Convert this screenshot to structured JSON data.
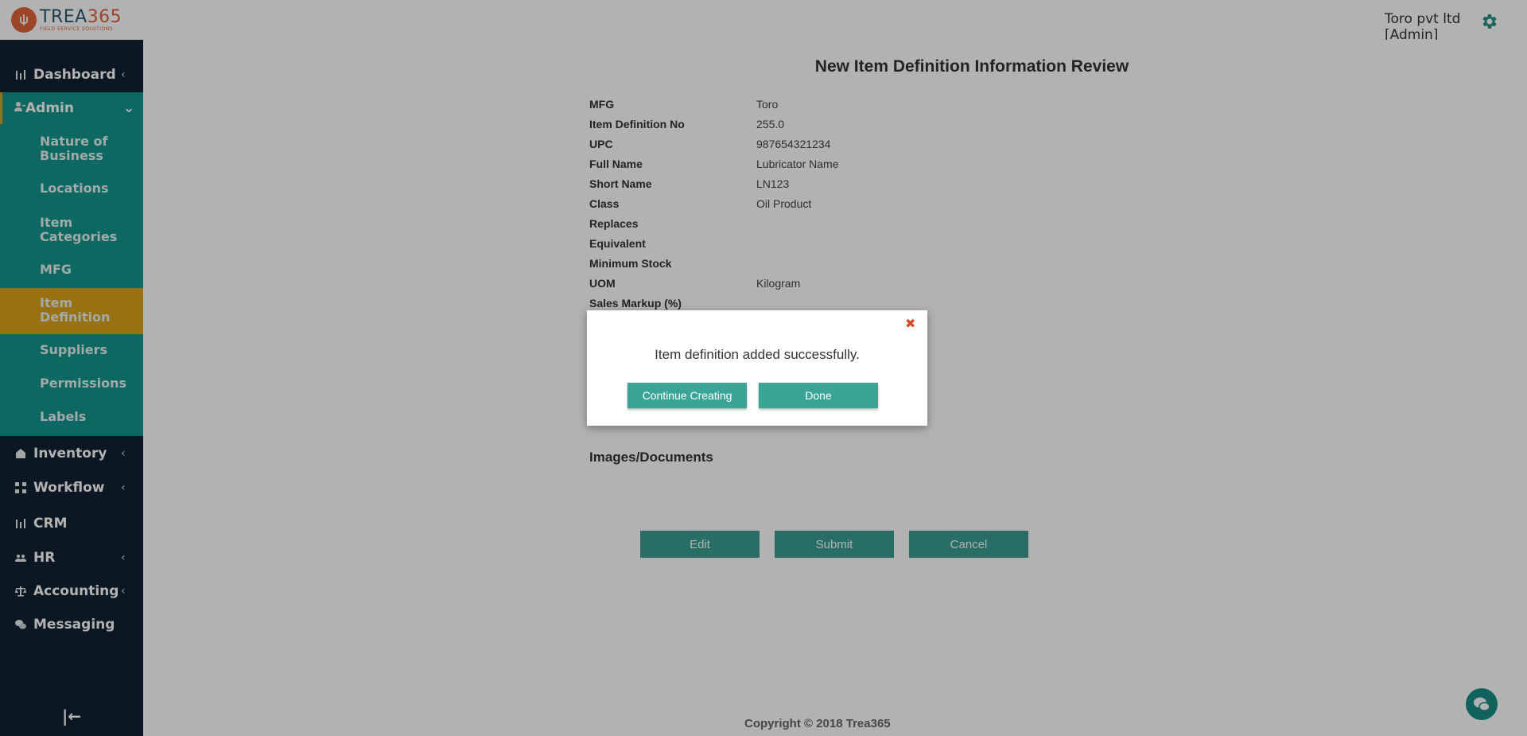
{
  "header": {
    "logo_name_left": "TREA",
    "logo_name_right": "365",
    "logo_tagline": "FIELD SERVICE SOLUTIONS",
    "company": "Toro pvt ltd",
    "role": "[Admin]",
    "settings_icon": "gear-icon"
  },
  "sidebar": {
    "items": [
      {
        "label": "Dashboard",
        "icon": "bar-chart-icon",
        "chevron": "‹"
      },
      {
        "label": "Admin",
        "icon": "user-icon",
        "chevron": "⌄"
      },
      {
        "label": "Inventory",
        "icon": "home-icon",
        "chevron": "‹"
      },
      {
        "label": "Workflow",
        "icon": "workflow-icon",
        "chevron": "‹"
      },
      {
        "label": "CRM",
        "icon": "bar-chart-icon",
        "chevron": ""
      },
      {
        "label": "HR",
        "icon": "users-icon",
        "chevron": "‹"
      },
      {
        "label": "Accounting",
        "icon": "scale-icon",
        "chevron": "‹"
      },
      {
        "label": "Messaging",
        "icon": "chat-icon",
        "chevron": ""
      }
    ],
    "admin_sub_items": [
      {
        "line1": "Nature of",
        "line2": "Business"
      },
      {
        "line1": "Locations",
        "line2": ""
      },
      {
        "line1": "Item",
        "line2": "Categories"
      },
      {
        "line1": "MFG",
        "line2": ""
      },
      {
        "line1": "Item",
        "line2": "Definition"
      },
      {
        "line1": "Suppliers",
        "line2": ""
      },
      {
        "line1": "Permissions",
        "line2": ""
      },
      {
        "line1": "Labels",
        "line2": ""
      }
    ],
    "collapse_label": "|←"
  },
  "main": {
    "title": "New Item Definition Information Review",
    "fields": [
      {
        "label": "MFG",
        "value": "Toro"
      },
      {
        "label": "Item Definition No",
        "value": "255.0"
      },
      {
        "label": "UPC",
        "value": "987654321234"
      },
      {
        "label": "Full Name",
        "value": "Lubricator Name"
      },
      {
        "label": "Short Name",
        "value": "LN123"
      },
      {
        "label": "Class",
        "value": "Oil Product"
      },
      {
        "label": "Replaces",
        "value": ""
      },
      {
        "label": "Equivalent",
        "value": ""
      },
      {
        "label": "Minimum Stock",
        "value": ""
      },
      {
        "label": "UOM",
        "value": "Kilogram"
      },
      {
        "label": "Sales Markup (%)",
        "value": ""
      }
    ],
    "images_section": "Images/Documents",
    "buttons": {
      "edit": "Edit",
      "submit": "Submit",
      "cancel": "Cancel"
    },
    "footer": "Copyright © 2018 Trea365"
  },
  "modal": {
    "close": "✖",
    "message": "Item definition added successfully.",
    "continue_label": "Continue Creating",
    "done_label": "Done"
  },
  "colors": {
    "sidebar_bg": "#102231",
    "admin_bg": "#12958a",
    "active_bg": "#d9a21b",
    "button_bg": "#3a9e90",
    "brand_orange": "#e0643a"
  }
}
